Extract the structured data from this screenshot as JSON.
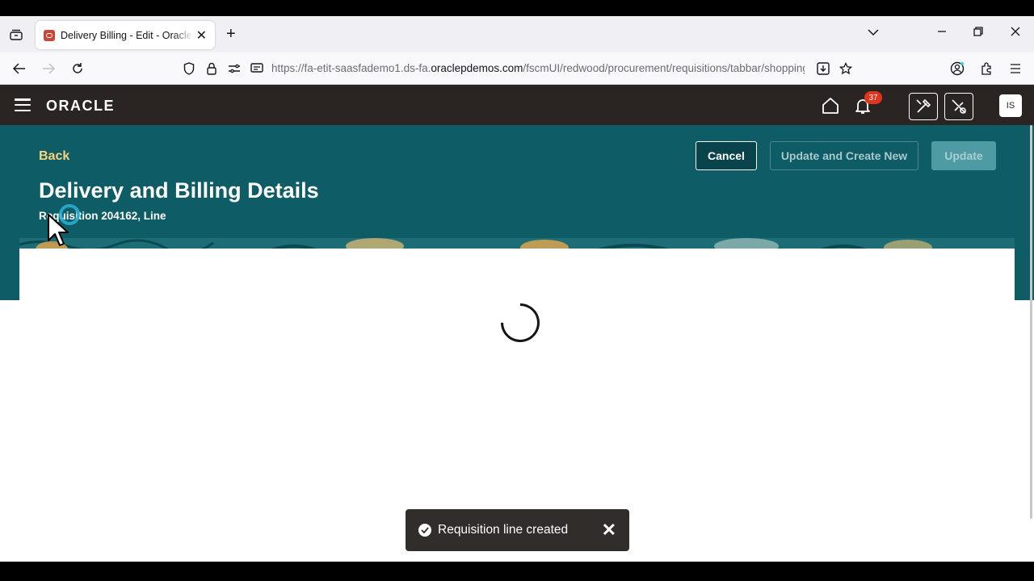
{
  "browser": {
    "tab_title": "Delivery Billing - Edit - Oracle Fusion Cloud Applications",
    "url_prefix": "https://fa-etit-saasfademo1.ds-fa.",
    "url_domain": "oraclepdemos.com",
    "url_path": "/fscmUI/redwood/procurement/requisitions/tabbar/shopping"
  },
  "header": {
    "logo": "ORACLE",
    "notification_count": "37",
    "avatar_initials": "IS"
  },
  "page": {
    "back_label": "Back",
    "title": "Delivery and Billing Details",
    "subtitle": "Requisition 204162, Line",
    "cancel_label": "Cancel",
    "update_create_new_label": "Update and Create New",
    "update_label": "Update"
  },
  "toast": {
    "message": "Requisition line created"
  },
  "colors": {
    "header_bg": "#2a2522",
    "band_bg": "#0e5c66",
    "back_link": "#f8d57b",
    "badge": "#e1341e"
  }
}
